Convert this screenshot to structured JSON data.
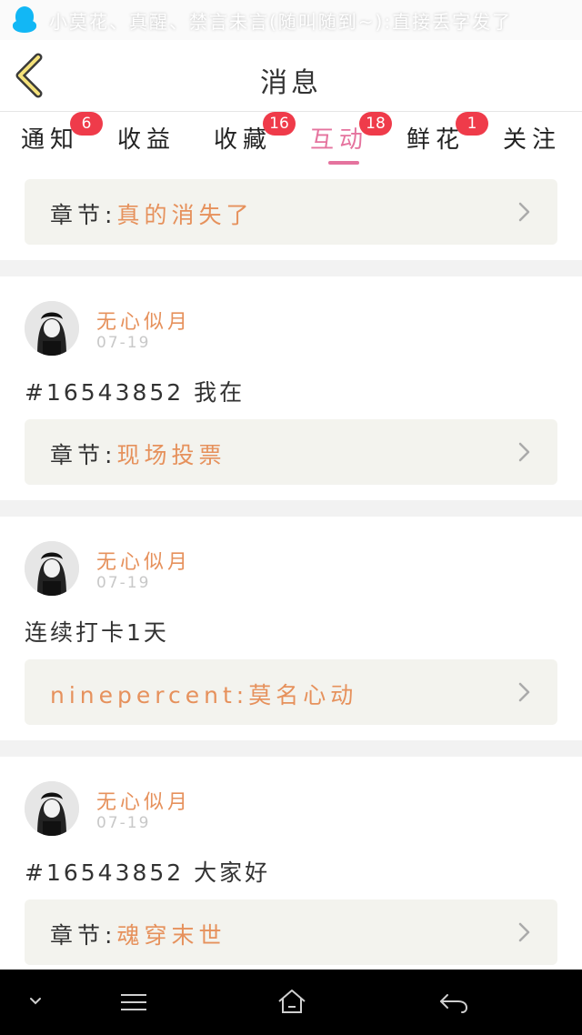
{
  "status_bar": {
    "ticker": "小莫花、真醒、禁言未言(随叫随到~):直接丢字发了",
    "notification_icon": "qq-penguin-icon"
  },
  "header": {
    "title": "消息",
    "back_icon": "back-chevron-icon"
  },
  "tabs": [
    {
      "label": "通知",
      "badge": "6"
    },
    {
      "label": "收益",
      "badge": ""
    },
    {
      "label": "收藏",
      "badge": "16"
    },
    {
      "label": "互动",
      "badge": "18",
      "active": true
    },
    {
      "label": "鲜花",
      "badge": "1"
    },
    {
      "label": "关注",
      "badge": ""
    }
  ],
  "colors": {
    "accent_pink": "#e5739e",
    "badge_red": "#ef3b4a",
    "link_orange": "#e6915c"
  },
  "messages": [
    {
      "ref_prefix": "章节:",
      "ref_title": "真的消失了"
    },
    {
      "username": "无心似月",
      "date": "07-19",
      "comment": "#16543852 我在",
      "ref_prefix": "章节:",
      "ref_title": "现场投票"
    },
    {
      "username": "无心似月",
      "date": "07-19",
      "comment": "连续打卡1天",
      "ref_prefix": "",
      "ref_title": "ninepercent:莫名心动"
    },
    {
      "username": "无心似月",
      "date": "07-19",
      "comment": "#16543852 大家好",
      "ref_prefix": "章节:",
      "ref_title": "魂穿末世"
    }
  ],
  "nav_bar": {
    "buttons": [
      "chevron-down-icon",
      "menu-icon",
      "home-icon",
      "back-arrow-icon"
    ]
  }
}
